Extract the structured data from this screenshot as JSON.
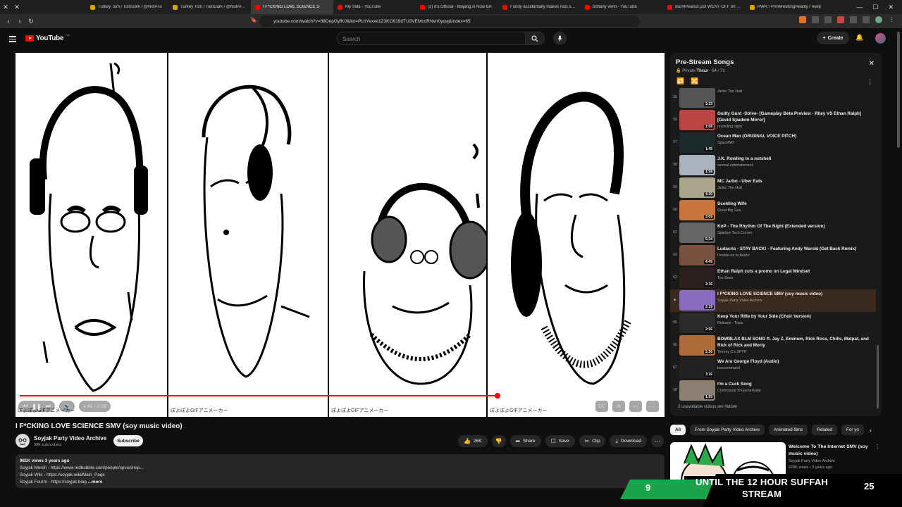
{
  "browser": {
    "tabs": [
      {
        "label": "Turkey Tom / TomDark / @NotATu",
        "color": "#d9a400",
        "active": false
      },
      {
        "label": "Turkey Tom / TomDark / @NotAT...",
        "color": "#d9a400",
        "active": false
      },
      {
        "label": "I F*CKING LOVE SCIENCE S",
        "color": "#ff0000",
        "active": true
      },
      {
        "label": "My Side - YouTube",
        "color": "#ff0000",
        "active": false
      },
      {
        "label": "(2) It's Official - Mojang is Now BA",
        "color": "#ff0000",
        "active": false
      },
      {
        "label": "Fundy accidentally makes nazi sym",
        "color": "#ff0000",
        "active": false
      },
      {
        "label": "brittany venti - YouTube",
        "color": "#ff0000",
        "active": false
      },
      {
        "label": "BurntPeanut just WENT OFF on VT",
        "color": "#ff0000",
        "active": false
      },
      {
        "label": "PWR / ProWrestlingReality / realp",
        "color": "#d9a400",
        "active": false
      }
    ],
    "url": "youtube.com/watch?v=ft8DepGyfK0&list=PLhYexxe1Z3KO919dTU3VEMcoRNvn0yqvj&index=65"
  },
  "header": {
    "logo_text": "YouTube",
    "country": "CA",
    "search_placeholder": "Search",
    "create_label": "Create"
  },
  "player": {
    "panel_caption": "ぽよぽよGIFアニメーカー",
    "time": "1:42 / 2:18",
    "progress": 0.746
  },
  "video": {
    "title": "I F*CKING LOVE SCIENCE SMV (soy music video)",
    "channel": "Soyjak Party Video Archive",
    "subscribers": "39K subscribers",
    "subscribe_label": "Subscribe",
    "likes": "26K",
    "share_label": "Share",
    "save_label": "Save",
    "clip_label": "Clip",
    "download_label": "Download",
    "views_date": "981K views  3 years ago",
    "desc_lines": [
      "Soyjak Merch - https://www.redbubble.com/people/spva/shop...",
      "Soyjak Wiki - https://soyjak.wiki/Main_Page",
      "Soyjak Fourm - https://soyjak.blog"
    ],
    "more_label": "...more"
  },
  "playlist": {
    "title": "Pre-Stream Songs",
    "privacy": "Private",
    "owner": "Thrax",
    "position": "64 / 71",
    "hidden_note": "3 unavailable videos are hidden",
    "items": [
      {
        "num": "55",
        "title": "",
        "channel": "Jarbo The Hutt",
        "duration": "3:33",
        "thumb": "#555"
      },
      {
        "num": "56",
        "title": "Guilty Gunt -Strive- [Gameplay Beta Preview - Riley VS Ethan Ralph] [David Spadem Mirror]",
        "channel": "recording ralph",
        "duration": "1:08",
        "thumb": "#b44"
      },
      {
        "num": "57",
        "title": "Ocean Man (ORIGINAL VOICE PITCH)",
        "channel": "SpaceWD",
        "duration": "1:45",
        "thumb": "#1d2a2a"
      },
      {
        "num": "58",
        "title": "J.K. Rowling in a nutshell",
        "channel": "surreal entertainment",
        "duration": "1:58",
        "thumb": "#a9b3c0"
      },
      {
        "num": "59",
        "title": "MC Jarbo - Uber Eats",
        "channel": "Jarbo The Hutt",
        "duration": "4:30",
        "thumb": "#aaa48a"
      },
      {
        "num": "60",
        "title": "Scolding Wife",
        "channel": "Great Big Sea",
        "duration": "3:09",
        "thumb": "#c8743a"
      },
      {
        "num": "61",
        "title": "KoP - The Rhythm Of The Night (Extended version)",
        "channel": "Sparkys Tech Corner",
        "duration": "5:34",
        "thumb": "#666"
      },
      {
        "num": "62",
        "title": "Ludacris - STAY BACK! - Featuring Andy Warski (Get Back Remix)",
        "channel": "Double-on to Andre",
        "duration": "4:45",
        "thumb": "#7a5040"
      },
      {
        "num": "63",
        "title": "Ethan Ralph cuts a promo on Legal Mindset",
        "channel": "Too Soon",
        "duration": "2:36",
        "thumb": "#2c1f1f"
      },
      {
        "num": "▶",
        "title": "I F*CKING LOVE SCIENCE SMV (soy music video)",
        "channel": "Soyjak Party Video Archive",
        "duration": "2:19",
        "thumb": "#8b6bc0",
        "current": true
      },
      {
        "num": "65",
        "title": "Keep Your Rifle by Your Side (Choir Version)",
        "channel": "Release - Topic",
        "duration": "2:56",
        "thumb": "#2a2a2a"
      },
      {
        "num": "66",
        "title": "BOWBLAX BLM SONG ft. Jay Z, Eminem, Rick Ross, Chills, Matpat, and Rick of Rick and Morty",
        "channel": "Tommy C's SFTP",
        "duration": "2:26",
        "thumb": "#b06b3a"
      },
      {
        "num": "67",
        "title": "We Are George Floyd (Audio)",
        "channel": "boxcommand",
        "duration": "3:16",
        "thumb": "#222"
      },
      {
        "num": "68",
        "title": "I'm a Cuck Song",
        "channel": "Commissar of GamerGate",
        "duration": "1:59",
        "thumb": "#8d8073"
      }
    ]
  },
  "chips": [
    "All",
    "From Soyjak Party Video Archive",
    "Animated films",
    "Related",
    "For yo"
  ],
  "related": {
    "title": "Welcome To The Internet SMV (soy music video)",
    "channel": "Soyjak Party Video Archive",
    "meta": "228K views • 3 years ago"
  },
  "overlay": {
    "left_number": "9",
    "text": "UNTIL THE 12 HOUR SUFFAH STREAM",
    "right_number": "25"
  }
}
